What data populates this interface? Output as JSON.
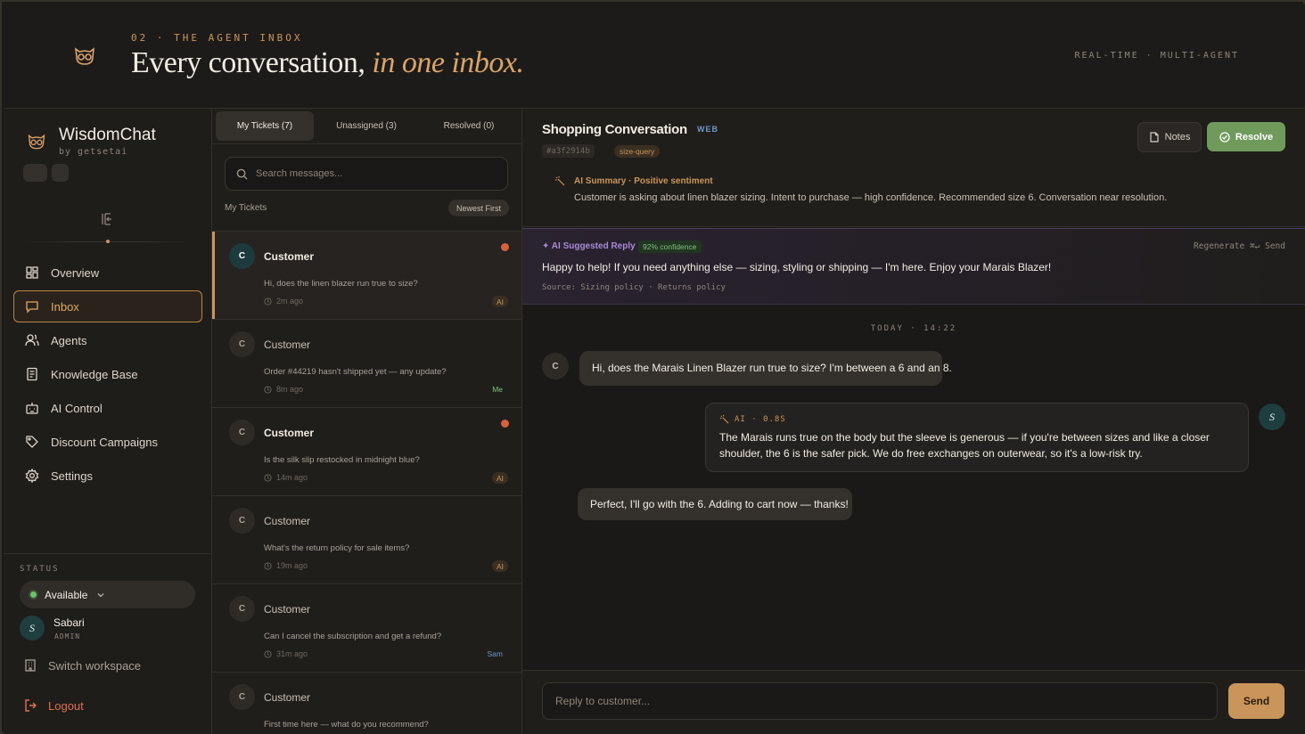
{
  "hero": {
    "eyebrow": "02 · THE AGENT INBOX",
    "title_main": "Every conversation,",
    "title_accent": "in one inbox.",
    "tagline": "REAL-TIME · MULTI-AGENT",
    "logo_icon": "owl-icon"
  },
  "sidebar": {
    "brand_name": "WisdomChat",
    "brand_sub": "by getsetai",
    "collapse_icon": "sidebar-collapse-icon",
    "nav": [
      {
        "label": "Overview",
        "icon": "grid-icon",
        "active": false
      },
      {
        "label": "Inbox",
        "icon": "chat-icon",
        "active": true
      },
      {
        "label": "Agents",
        "icon": "users-icon",
        "active": false
      },
      {
        "label": "Knowledge Base",
        "icon": "book-icon",
        "active": false
      },
      {
        "label": "AI Control",
        "icon": "bot-icon",
        "active": false
      },
      {
        "label": "Discount Campaigns",
        "icon": "tag-icon",
        "active": false
      },
      {
        "label": "Settings",
        "icon": "gear-icon",
        "active": false
      }
    ],
    "status_label": "STATUS",
    "status_value": "Available",
    "user": {
      "initial": "S",
      "name": "Sabari",
      "role": "ADMIN"
    },
    "switch_workspace": "Switch workspace",
    "logout": "Logout"
  },
  "tickets": {
    "tabs": [
      {
        "label": "My Tickets (7)",
        "active": true
      },
      {
        "label": "Unassigned (3)",
        "active": false
      },
      {
        "label": "Resolved (0)",
        "active": false
      }
    ],
    "search_placeholder": "Search messages...",
    "list_label": "My Tickets",
    "sort_label": "Newest First",
    "items": [
      {
        "initial": "C",
        "name": "Customer",
        "message": "Hi, does the linen blazer run true to size?",
        "time": "2m ago",
        "tag": "AI",
        "unread": true,
        "active": true
      },
      {
        "initial": "C",
        "name": "Customer",
        "message": "Order #44219 hasn't shipped yet — any update?",
        "time": "8m ago",
        "tag": "Me",
        "unread": false,
        "active": false
      },
      {
        "initial": "C",
        "name": "Customer",
        "message": "Is the silk slip restocked in midnight blue?",
        "time": "14m ago",
        "tag": "AI",
        "unread": true,
        "active": false
      },
      {
        "initial": "C",
        "name": "Customer",
        "message": "What's the return policy for sale items?",
        "time": "19m ago",
        "tag": "AI",
        "unread": false,
        "active": false
      },
      {
        "initial": "C",
        "name": "Customer",
        "message": "Can I cancel the subscription and get a refund?",
        "time": "31m ago",
        "tag": "Sam",
        "unread": false,
        "active": false
      },
      {
        "initial": "C",
        "name": "Customer",
        "message": "First time here — what do you recommend?",
        "time": "",
        "tag": "",
        "unread": false,
        "active": false
      }
    ]
  },
  "conversation": {
    "title": "Shopping Conversation",
    "channel": "WEB",
    "id": "#a3f2914b",
    "tag": "size-query",
    "notes_label": "Notes",
    "resolve_label": "Resolve",
    "summary_label": "AI Summary · Positive sentiment",
    "summary_text": "Customer is asking about linen blazer sizing. Intent to purchase — high confidence. Recommended size 6. Conversation near resolution.",
    "suggest_label": "✦ AI Suggested Reply",
    "suggest_confidence": "92% confidence",
    "suggest_actions": "Regenerate  ⌘↵ Send",
    "suggest_text": "Happy to help! If you need anything else — sizing, styling or shipping — I'm here. Enjoy your Marais Blazer!",
    "suggest_source": "Source: Sizing policy · Returns policy",
    "date_sep": "TODAY · 14:22",
    "messages": [
      {
        "from": "customer",
        "initial": "C",
        "text": "Hi, does the Marais Linen Blazer run true to size? I'm between a 6 and an 8."
      },
      {
        "from": "ai",
        "initial": "S",
        "meta": "AI · 0.8S",
        "text": "The Marais runs true on the body but the sleeve is generous — if you're between sizes and like a closer shoulder, the 6 is the safer pick. We do free exchanges on outerwear, so it's a low-risk try."
      },
      {
        "from": "customer",
        "text": "Perfect, I'll go with the 6. Adding to cart now — thanks!"
      }
    ],
    "reply_placeholder": "Reply to customer...",
    "send_label": "Send"
  },
  "colors": {
    "accent": "#c9955a",
    "success": "#6f9a5c",
    "unread": "#d6613f",
    "ai_purple": "#a989d6",
    "web_blue": "#6a99c7"
  }
}
